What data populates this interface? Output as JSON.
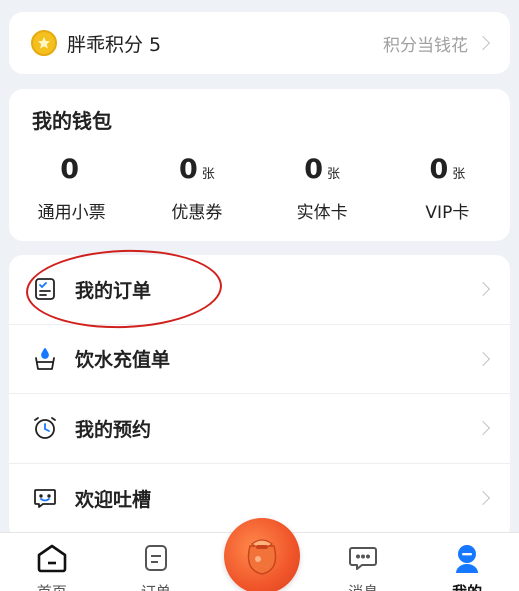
{
  "points": {
    "label": "胖乖积分 5",
    "link_text": "积分当钱花"
  },
  "wallet": {
    "title": "我的钱包",
    "items": [
      {
        "value": "0",
        "unit": "",
        "label": "通用小票"
      },
      {
        "value": "0",
        "unit": "张",
        "label": "优惠券"
      },
      {
        "value": "0",
        "unit": "张",
        "label": "实体卡"
      },
      {
        "value": "0",
        "unit": "张",
        "label": "VIP卡"
      }
    ]
  },
  "menu": [
    {
      "label": "我的订单",
      "icon": "order-list-icon"
    },
    {
      "label": "饮水充值单",
      "icon": "water-cup-icon"
    },
    {
      "label": "我的预约",
      "icon": "alarm-clock-icon"
    },
    {
      "label": "欢迎吐槽",
      "icon": "feedback-chat-icon"
    }
  ],
  "nav": [
    {
      "label": "首页",
      "icon": "home-icon"
    },
    {
      "label": "订单",
      "icon": "order-doc-icon"
    },
    {
      "label": "",
      "icon": "lucky-bag-icon"
    },
    {
      "label": "消息",
      "icon": "message-icon"
    },
    {
      "label": "我的",
      "icon": "profile-icon"
    }
  ],
  "colors": {
    "accent": "#1677ff",
    "highlight": "#d0201b",
    "coin": "#f4c01e"
  }
}
